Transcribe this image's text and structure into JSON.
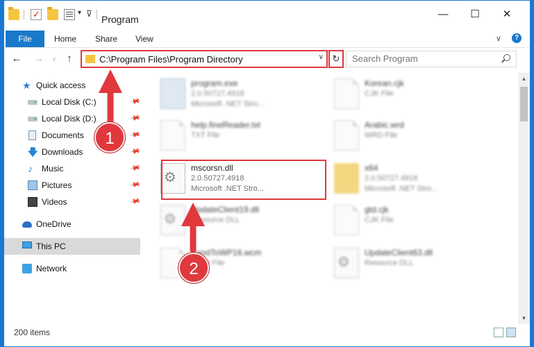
{
  "window": {
    "title": "Program",
    "controls": {
      "minimize": "—",
      "maximize": "☐",
      "close": "✕"
    }
  },
  "ribbon": {
    "tabs": [
      "File",
      "Home",
      "Share",
      "View"
    ],
    "expand_caret": "∨",
    "help": "?"
  },
  "nav": {
    "back": "←",
    "forward": "→",
    "up": "↑",
    "recent_caret": "∨"
  },
  "address": {
    "path": "C:\\Program Files\\Program Directory",
    "dropdown": "∨",
    "refresh": "↻"
  },
  "search": {
    "placeholder": "Search Program"
  },
  "sidebar": {
    "items": [
      {
        "label": "Quick access",
        "icon": "star-icon",
        "pinned": false
      },
      {
        "label": "Local Disk (C:)",
        "icon": "drive-icon",
        "pinned": true
      },
      {
        "label": "Local Disk (D:)",
        "icon": "drive-icon",
        "pinned": true
      },
      {
        "label": "Documents",
        "icon": "documents-icon",
        "pinned": true
      },
      {
        "label": "Downloads",
        "icon": "download-icon",
        "pinned": true
      },
      {
        "label": "Music",
        "icon": "music-icon",
        "pinned": true
      },
      {
        "label": "Pictures",
        "icon": "pictures-icon",
        "pinned": true
      },
      {
        "label": "Videos",
        "icon": "videos-icon",
        "pinned": true
      },
      {
        "label": "OneDrive",
        "icon": "cloud-icon",
        "pinned": false
      },
      {
        "label": "This PC",
        "icon": "computer-icon",
        "pinned": false,
        "selected": true
      },
      {
        "label": "Network",
        "icon": "network-icon",
        "pinned": false
      }
    ],
    "pin_glyph": "📌"
  },
  "files": [
    {
      "name": "program.exe",
      "line2": "2.0.50727.4918",
      "line3": "Microsoft .NET Stro...",
      "icon": "exe-icon"
    },
    {
      "name": "Korean.cjk",
      "line2": "CJK File",
      "line3": "",
      "icon": "document-icon"
    },
    {
      "name": "help.fineReader.txt",
      "line2": "TXT File",
      "line3": "",
      "icon": "document-icon"
    },
    {
      "name": "Arabic.wrd",
      "line2": "WRD File",
      "line3": "",
      "icon": "document-icon"
    },
    {
      "name": "mscorsn.dll",
      "line2": "2.0.50727.4918",
      "line3": "Microsoft .NET Stro...",
      "icon": "dll-gear-icon"
    },
    {
      "name": "x64",
      "line2": "2.0.50727.4918",
      "line3": "Microsoft .NET Stro...",
      "icon": "folder-icon"
    },
    {
      "name": "UpdateClient19.dll",
      "line2": "Resource DLL",
      "line3": "",
      "icon": "dll-gear-icon"
    },
    {
      "name": "gtd.cjk",
      "line2": "CJK File",
      "line3": "",
      "icon": "document-icon"
    },
    {
      "name": "SendToWP16.wcm",
      "line2": "WCM File",
      "line3": "",
      "icon": "document-icon"
    },
    {
      "name": "UpdateClient63.dll",
      "line2": "Resource DLL",
      "line3": "",
      "icon": "dll-gear-icon"
    }
  ],
  "status": {
    "item_count": "200 items"
  },
  "annotations": {
    "step1": "1",
    "step2": "2",
    "color": "#e0383d"
  }
}
